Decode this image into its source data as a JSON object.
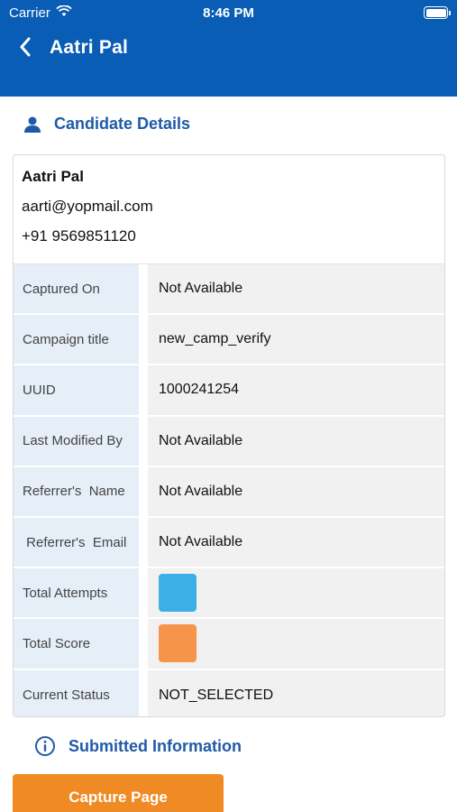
{
  "status_bar": {
    "carrier": "Carrier",
    "time": "8:46 PM"
  },
  "nav": {
    "title": "Aatri Pal"
  },
  "candidate_section": {
    "heading": "Candidate Details",
    "name": "Aatri Pal",
    "email": "aarti@yopmail.com",
    "phone": "+91 9569851120"
  },
  "details": [
    {
      "label": "Captured On",
      "value": "Not Available"
    },
    {
      "label": "Campaign title",
      "value": "new_camp_verify"
    },
    {
      "label": "UUID",
      "value": "1000241254"
    },
    {
      "label": "Last Modified By",
      "value": "Not Available"
    },
    {
      "label": "Referrer's  Name",
      "value": "Not Available"
    },
    {
      "label": " Referrer's  Email",
      "value": "Not Available"
    },
    {
      "label": "Total Attempts",
      "swatch": "#3cb0e6"
    },
    {
      "label": "Total Score",
      "swatch": "#f5944a"
    },
    {
      "label": "Current Status",
      "value": "NOT_SELECTED"
    }
  ],
  "submitted_section": {
    "heading": "Submitted Information"
  },
  "actions": {
    "capture_label": "Capture Page"
  },
  "colors": {
    "header_blue": "#0a5db4",
    "accent_text": "#1f5aa8",
    "button_orange": "#f08a24"
  }
}
